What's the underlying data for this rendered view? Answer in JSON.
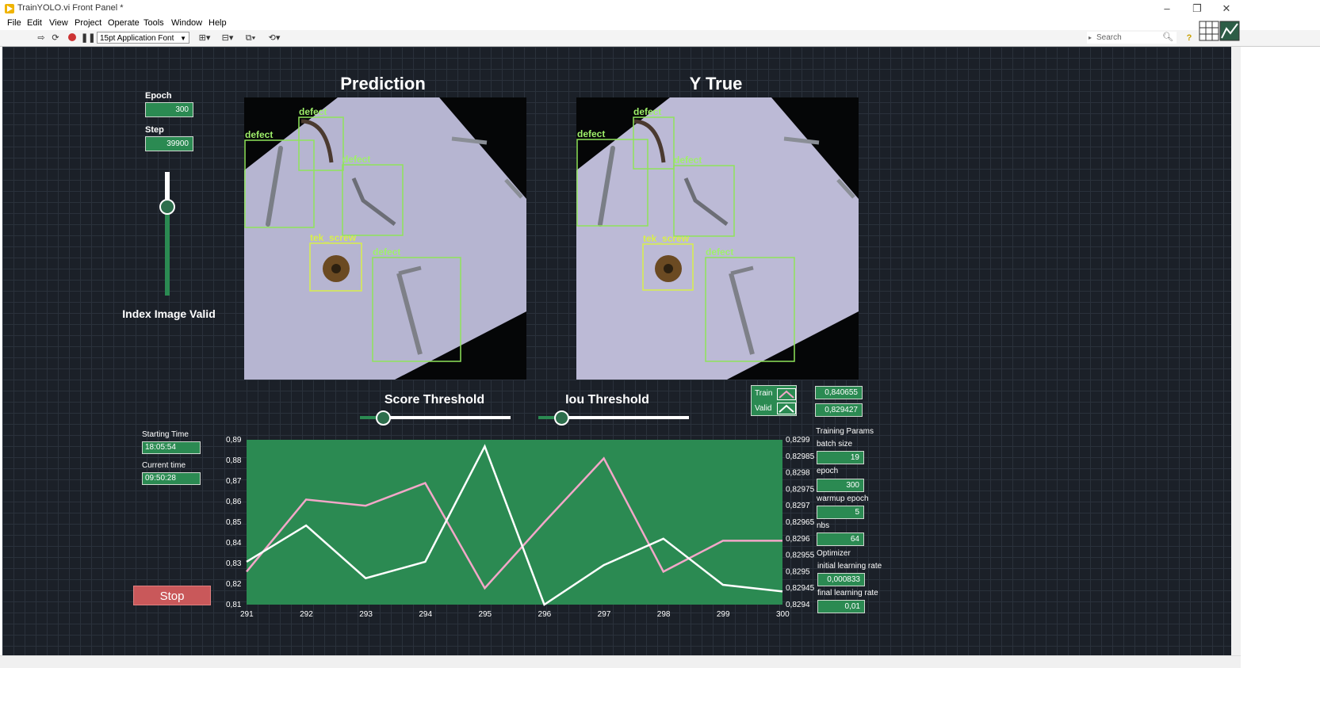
{
  "window": {
    "title": "TrainYOLO.vi Front Panel *",
    "buttons": {
      "minimize": "–",
      "restore": "❐",
      "close": "✕"
    }
  },
  "menu": [
    "File",
    "Edit",
    "View",
    "Project",
    "Operate",
    "Tools",
    "Window",
    "Help"
  ],
  "toolbar": {
    "font": "15pt Application Font",
    "search_placeholder": "Search",
    "icons": [
      "run-arrow-icon",
      "run-continuous-icon",
      "abort-icon",
      "pause-icon",
      "align-icon",
      "distribute-icon",
      "resize-icon",
      "reorder-icon",
      "search-icon",
      "help-icon"
    ]
  },
  "controls": {
    "epoch": {
      "label": "Epoch",
      "value": "300"
    },
    "step": {
      "label": "Step",
      "value": "39900"
    },
    "index_slider": {
      "label": "Index Image Valid",
      "level": 0.72
    },
    "starting_time": {
      "label": "Starting Time",
      "value": "18:05:54"
    },
    "current_time": {
      "label": "Current time",
      "value": "09:50:28"
    },
    "stop_label": "Stop"
  },
  "images": {
    "prediction_title": "Prediction",
    "ytrue_title": "Y True",
    "prediction_boxes": [
      "defect",
      "defect",
      "defect",
      "tek_screw",
      "defect"
    ],
    "ytrue_boxes": [
      "defect",
      "defect",
      "defect",
      "tek_screw",
      "defect"
    ]
  },
  "thresholds": {
    "score": {
      "label": "Score Threshold",
      "level": 0.15
    },
    "iou": {
      "label": "Iou Threshold",
      "level": 0.15
    }
  },
  "legend": {
    "train_label": "Train",
    "valid_label": "Valid",
    "train_value": "0,840655",
    "valid_value": "0,829427"
  },
  "params": {
    "title": "Training Params",
    "items": [
      {
        "label": "batch size",
        "value": "19"
      },
      {
        "label": "epoch",
        "value": "300"
      },
      {
        "label": "warmup epoch",
        "value": "5"
      },
      {
        "label": "nbs",
        "value": "64"
      }
    ],
    "optimizer_label": "Optimizer",
    "lr_items": [
      {
        "label": "initial learning rate",
        "value": "0,000833"
      },
      {
        "label": "final learning rate",
        "value": "0,01"
      }
    ]
  },
  "chart_data": {
    "type": "line",
    "x": [
      291,
      292,
      293,
      294,
      295,
      296,
      297,
      298,
      299,
      300
    ],
    "x_ticks": [
      "291",
      "292",
      "293",
      "294",
      "295",
      "296",
      "297",
      "298",
      "299",
      "300"
    ],
    "y_left_ticks": [
      "0,89",
      "0,88",
      "0,87",
      "0,86",
      "0,85",
      "0,84",
      "0,83",
      "0,82",
      "0,81"
    ],
    "y_right_ticks": [
      "0,8299",
      "0,82985",
      "0,8298",
      "0,82975",
      "0,8297",
      "0,82965",
      "0,8296",
      "0,82955",
      "0,8295",
      "0,82945",
      "0,8294"
    ],
    "ylim_left": [
      0.81,
      0.89
    ],
    "ylim_right": [
      0.8294,
      0.8299
    ],
    "series": [
      {
        "name": "Train",
        "axis": "left",
        "color": "#f2a7c8",
        "values": [
          0.826,
          0.861,
          0.858,
          0.869,
          0.818,
          0.85,
          0.881,
          0.826,
          0.841,
          0.841
        ]
      },
      {
        "name": "Valid",
        "axis": "right",
        "color": "#ffffff",
        "values": [
          0.82953,
          0.82964,
          0.82948,
          0.82953,
          0.82988,
          0.8294,
          0.82952,
          0.8296,
          0.82946,
          0.82944
        ]
      }
    ],
    "background": "#2b8a52"
  }
}
